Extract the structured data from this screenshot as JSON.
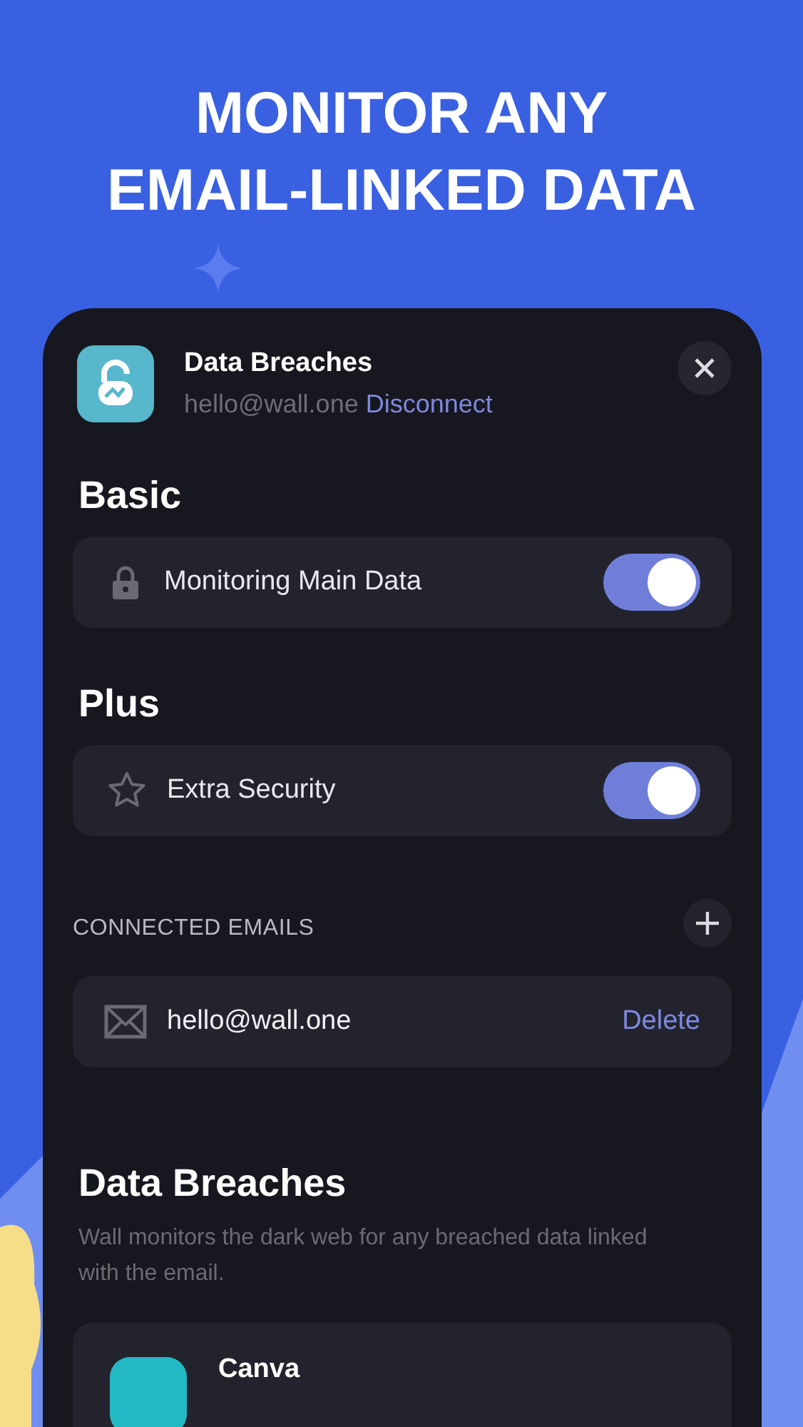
{
  "headline": [
    "MONITOR ANY",
    "EMAIL-LINKED DATA"
  ],
  "sheet": {
    "title": "Data Breaches",
    "email": "hello@wall.one",
    "action": "Disconnect"
  },
  "sections": [
    {
      "title": "Basic",
      "rows": [
        {
          "kind": "toggle",
          "label": "Monitoring Main Data",
          "on": true
        }
      ]
    },
    {
      "title": "Plus",
      "rows": [
        {
          "kind": "toggle",
          "label": "Extra Security",
          "on": true
        }
      ]
    }
  ],
  "connected_emails": {
    "heading": "CONNECTED EMAILS",
    "items": [
      {
        "email": "hello@wall.one",
        "action": "Delete"
      }
    ]
  },
  "breaches": {
    "title": "Data Breaches",
    "description": "Wall monitors the dark web for any breached data linked with the email.",
    "items": [
      {
        "name": "Canva"
      }
    ]
  }
}
